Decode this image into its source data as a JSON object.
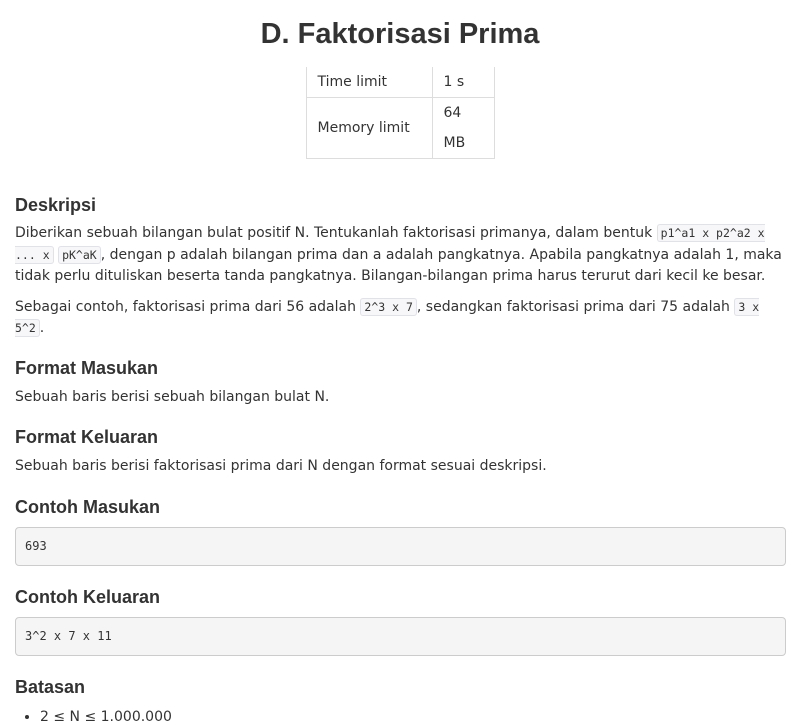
{
  "title": "D. Faktorisasi Prima",
  "limits": [
    {
      "label": "Time limit",
      "value": "1 s"
    },
    {
      "label": "Memory limit",
      "value": "64 MB"
    }
  ],
  "deskripsi": {
    "heading": "Deskripsi",
    "p1_a": "Diberikan sebuah bilangan bulat positif N. Tentukanlah faktorisasi primanya, dalam bentuk ",
    "p1_code_1": "p1^a1 x p2^a2 x ... x",
    "p1_code_2": "pK^aK",
    "p1_b": ", dengan p adalah bilangan prima dan a adalah pangkatnya. Apabila pangkatnya adalah 1, maka tidak perlu dituliskan beserta tanda pangkatnya. Bilangan-bilangan prima harus terurut dari kecil ke besar.",
    "p2_a": "Sebagai contoh, faktorisasi prima dari 56 adalah ",
    "p2_code_1": "2^3 x 7",
    "p2_b": ", sedangkan faktorisasi prima dari 75 adalah ",
    "p2_code_2": "3 x 5^2",
    "p2_c": "."
  },
  "format_masukan": {
    "heading": "Format Masukan",
    "text": "Sebuah baris berisi sebuah bilangan bulat N."
  },
  "format_keluaran": {
    "heading": "Format Keluaran",
    "text": "Sebuah baris berisi faktorisasi prima dari N dengan format sesuai deskripsi."
  },
  "contoh_masukan": {
    "heading": "Contoh Masukan",
    "text": "693"
  },
  "contoh_keluaran": {
    "heading": "Contoh Keluaran",
    "text": "3^2 x 7 x 11"
  },
  "batasan": {
    "heading": "Batasan",
    "items": [
      "2 ≤ N ≤ 1.000.000"
    ]
  }
}
